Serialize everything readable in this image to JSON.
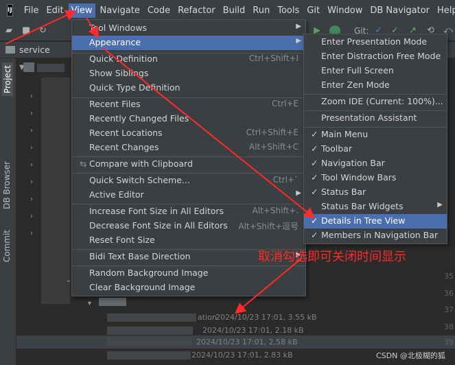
{
  "menubar": {
    "logo_text": "IJ",
    "items": [
      "File",
      "Edit",
      "View",
      "Navigate",
      "Code",
      "Refactor",
      "Build",
      "Run",
      "Tools",
      "Git",
      "Window",
      "DB Navigator",
      "Help"
    ],
    "active_index": 2
  },
  "toolbar": {
    "git_label": "Git:"
  },
  "project_tab": {
    "label": "service"
  },
  "left_stripe": {
    "project": "Project",
    "db_browser": "DB Browser",
    "commit": "Commit"
  },
  "view_menu": {
    "tool_windows": "Tool Windows",
    "appearance": "Appearance",
    "quick_definition": "Quick Definition",
    "quick_definition_sc": "Ctrl+Shift+I",
    "show_siblings": "Show Siblings",
    "quick_type_definition": "Quick Type Definition",
    "recent_files": "Recent Files",
    "recent_files_sc": "Ctrl+E",
    "recently_changed_files": "Recently Changed Files",
    "recent_locations": "Recent Locations",
    "recent_locations_sc": "Ctrl+Shift+E",
    "recent_changes": "Recent Changes",
    "recent_changes_sc": "Alt+Shift+C",
    "compare_with_clipboard": "Compare with Clipboard",
    "quick_switch_scheme": "Quick Switch Scheme...",
    "quick_switch_scheme_sc": "Ctrl+`",
    "active_editor": "Active Editor",
    "increase_font": "Increase Font Size in All Editors",
    "increase_font_sc": "Alt+Shift+.",
    "decrease_font": "Decrease Font Size in All Editors",
    "decrease_font_sc": "Alt+Shift+逗号",
    "reset_font": "Reset Font Size",
    "bidi": "Bidi Text Base Direction",
    "random_bg": "Random Background Image",
    "clear_bg": "Clear Background Image"
  },
  "appearance_menu": {
    "presentation_mode": "Enter Presentation Mode",
    "distraction_free": "Enter Distraction Free Mode",
    "full_screen": "Enter Full Screen",
    "zen_mode": "Enter Zen Mode",
    "zoom_ide": "Zoom IDE (Current: 100%)...",
    "presentation_assistant": "Presentation Assistant",
    "main_menu": "Main Menu",
    "toolbar": "Toolbar",
    "navigation_bar": "Navigation Bar",
    "tool_window_bars": "Tool Window Bars",
    "status_bar": "Status Bar",
    "status_bar_widgets": "Status Bar Widgets",
    "details_in_tree_view": "Details in Tree View",
    "members_in_nav_bar": "Members in Navigation Bar",
    "checked": [
      "main_menu",
      "toolbar",
      "navigation_bar",
      "tool_window_bars",
      "status_bar",
      "details_in_tree_view"
    ]
  },
  "tree": {
    "files": [
      {
        "name_suffix": "ation",
        "date": "2024/10/23 17:01, 3.55 kB"
      },
      {
        "name_suffix": "",
        "date": "2024/10/23 17:01, 2.18 kB"
      },
      {
        "name_suffix": "",
        "date": "2024/10/23 17:01, 2.58 kB"
      },
      {
        "name_suffix": "",
        "date": "2024/10/23 17:01, 2.83 kB"
      }
    ],
    "line_numbers": [
      "35",
      "36",
      "37",
      "38",
      "39"
    ]
  },
  "annotation": "取消勾选即可关闭时间显示",
  "watermark": "CSDN @北极糊的狐",
  "colors": {
    "menu_highlight": "#4b6eaf",
    "annotation": "#ff2a2a",
    "background": "#2b2d30"
  }
}
